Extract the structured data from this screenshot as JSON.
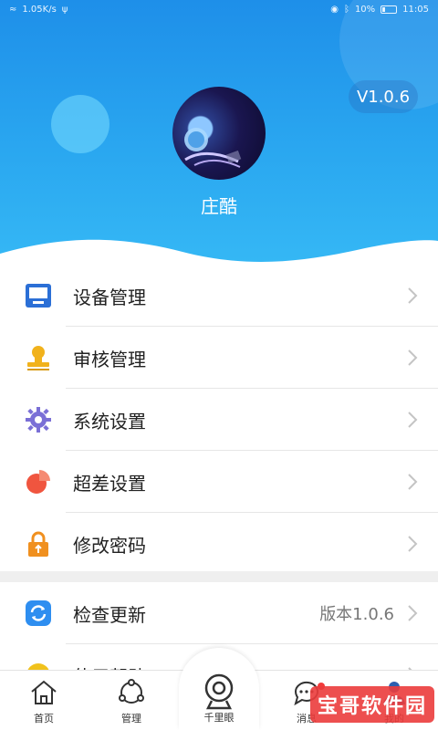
{
  "status_bar": {
    "left": "1.05K/s",
    "right": "10%",
    "time": "11:05"
  },
  "header": {
    "version": "V1.0.6",
    "username": "庄酷"
  },
  "menu": [
    {
      "label": "设备管理",
      "icon": "device-icon",
      "color": "#2b6fd6"
    },
    {
      "label": "审核管理",
      "icon": "stamp-icon",
      "color": "#f1b21c"
    },
    {
      "label": "系统设置",
      "icon": "gear-icon",
      "color": "#7a6fd6"
    },
    {
      "label": "超差设置",
      "icon": "pie-icon",
      "color": "#f0553f"
    },
    {
      "label": "修改密码",
      "icon": "lock-icon",
      "color": "#f0901f"
    }
  ],
  "menu2": [
    {
      "label": "检查更新",
      "right": "版本1.0.6",
      "icon": "refresh-icon",
      "color": "#2e8ef0"
    },
    {
      "label": "使用帮助",
      "icon": "help-icon",
      "color": "#f1c21c"
    }
  ],
  "bottom_nav": [
    {
      "label": "首页",
      "icon": "home-icon"
    },
    {
      "label": "管理",
      "icon": "network-icon"
    },
    {
      "label": "千里眼",
      "icon": "camera-icon"
    },
    {
      "label": "消息",
      "icon": "chat-icon"
    },
    {
      "label": "我的",
      "icon": "profile-icon"
    }
  ],
  "watermark": "宝哥软件园"
}
